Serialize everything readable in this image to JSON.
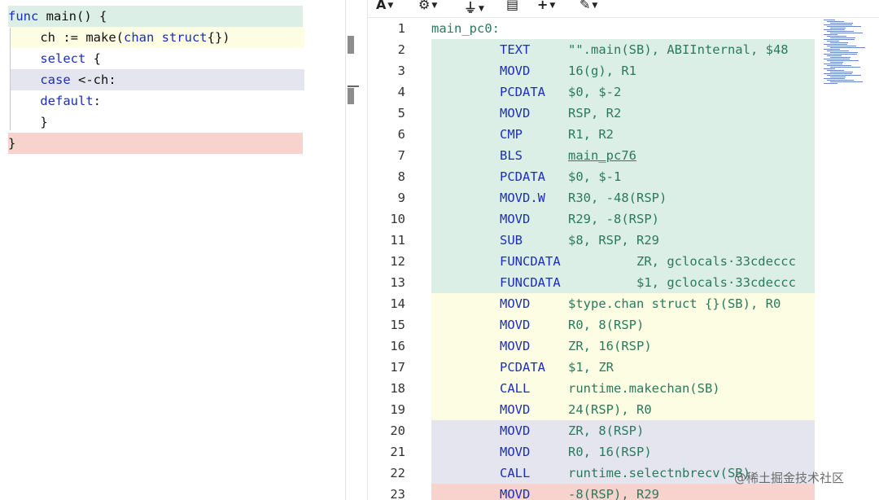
{
  "source": {
    "lines": [
      {
        "id": "l1",
        "parts": [
          {
            "t": "func",
            "kw": true
          },
          {
            "t": " main() {",
            "kw": false
          }
        ],
        "color": "green"
      },
      {
        "id": "l2",
        "parts": [
          {
            "t": "    ch := make(",
            "kw": false
          },
          {
            "t": "chan struct",
            "kw": true
          },
          {
            "t": "{})",
            "kw": false
          }
        ],
        "color": "yellow"
      },
      {
        "id": "l3",
        "parts": [
          {
            "t": "    ",
            "kw": false
          },
          {
            "t": "select",
            "kw": true
          },
          {
            "t": " {",
            "kw": false
          }
        ],
        "color": "white"
      },
      {
        "id": "l4",
        "parts": [
          {
            "t": "    ",
            "kw": false
          },
          {
            "t": "case",
            "kw": true
          },
          {
            "t": " <-ch:",
            "kw": false
          }
        ],
        "color": "purple"
      },
      {
        "id": "l5",
        "parts": [
          {
            "t": "    ",
            "kw": false
          },
          {
            "t": "default",
            "kw": true
          },
          {
            "t": ":",
            "kw": false
          }
        ],
        "color": "white"
      },
      {
        "id": "l6",
        "parts": [
          {
            "t": "    }",
            "kw": false
          }
        ],
        "color": "white"
      },
      {
        "id": "l7",
        "parts": [
          {
            "t": "}",
            "kw": false
          }
        ],
        "color": "red"
      }
    ]
  },
  "toolbar": {
    "font_btn": "A",
    "settings_icon": "gear-icon",
    "filter_icon": "filter-icon",
    "library_icon": "book-icon",
    "add_icon": "plus-icon",
    "tools_icon": "wrench-icon"
  },
  "asm": {
    "rows": [
      {
        "n": "1",
        "label": "main_pc0:",
        "bg": "none"
      },
      {
        "n": "2",
        "instr": "TEXT",
        "ops": "\"\".main(SB), ABIInternal, $48",
        "bg": "green"
      },
      {
        "n": "3",
        "instr": "MOVD",
        "ops": "16(g), R1",
        "bg": "green"
      },
      {
        "n": "4",
        "instr": "PCDATA",
        "ops": "$0, $-2",
        "bg": "green"
      },
      {
        "n": "5",
        "instr": "MOVD",
        "ops": "RSP, R2",
        "bg": "green"
      },
      {
        "n": "6",
        "instr": "CMP",
        "ops": "R1, R2",
        "bg": "green"
      },
      {
        "n": "7",
        "instr": "BLS",
        "ops": "main_pc76",
        "link": true,
        "bg": "green"
      },
      {
        "n": "8",
        "instr": "PCDATA",
        "ops": "$0, $-1",
        "bg": "green"
      },
      {
        "n": "9",
        "instr": "MOVD.W",
        "ops": "R30, -48(RSP)",
        "bg": "green"
      },
      {
        "n": "10",
        "instr": "MOVD",
        "ops": "R29, -8(RSP)",
        "bg": "green"
      },
      {
        "n": "11",
        "instr": "SUB",
        "ops": "$8, RSP, R29",
        "bg": "green"
      },
      {
        "n": "12",
        "instr": "FUNCDATA",
        "ops": "ZR, gclocals·33cdeccc",
        "far": true,
        "bg": "green"
      },
      {
        "n": "13",
        "instr": "FUNCDATA",
        "ops": "$1, gclocals·33cdeccc",
        "far": true,
        "bg": "green"
      },
      {
        "n": "14",
        "instr": "MOVD",
        "ops": "$type.chan struct {}(SB), R0",
        "bg": "yellow"
      },
      {
        "n": "15",
        "instr": "MOVD",
        "ops": "R0, 8(RSP)",
        "bg": "yellow"
      },
      {
        "n": "16",
        "instr": "MOVD",
        "ops": "ZR, 16(RSP)",
        "bg": "yellow"
      },
      {
        "n": "17",
        "instr": "PCDATA",
        "ops": "$1, ZR",
        "bg": "yellow"
      },
      {
        "n": "18",
        "instr": "CALL",
        "ops": "runtime.makechan(SB)",
        "bg": "yellow"
      },
      {
        "n": "19",
        "instr": "MOVD",
        "ops": "24(RSP), R0",
        "bg": "yellow"
      },
      {
        "n": "20",
        "instr": "MOVD",
        "ops": "ZR, 8(RSP)",
        "bg": "purple"
      },
      {
        "n": "21",
        "instr": "MOVD",
        "ops": "R0, 16(RSP)",
        "bg": "purple"
      },
      {
        "n": "22",
        "instr": "CALL",
        "ops": "runtime.selectnbrecv(SB)",
        "bg": "purple"
      },
      {
        "n": "23",
        "instr": "MOVD",
        "ops": "-8(RSP), R29",
        "bg": "red"
      }
    ]
  },
  "watermark": "@稀土掘金技术社区"
}
